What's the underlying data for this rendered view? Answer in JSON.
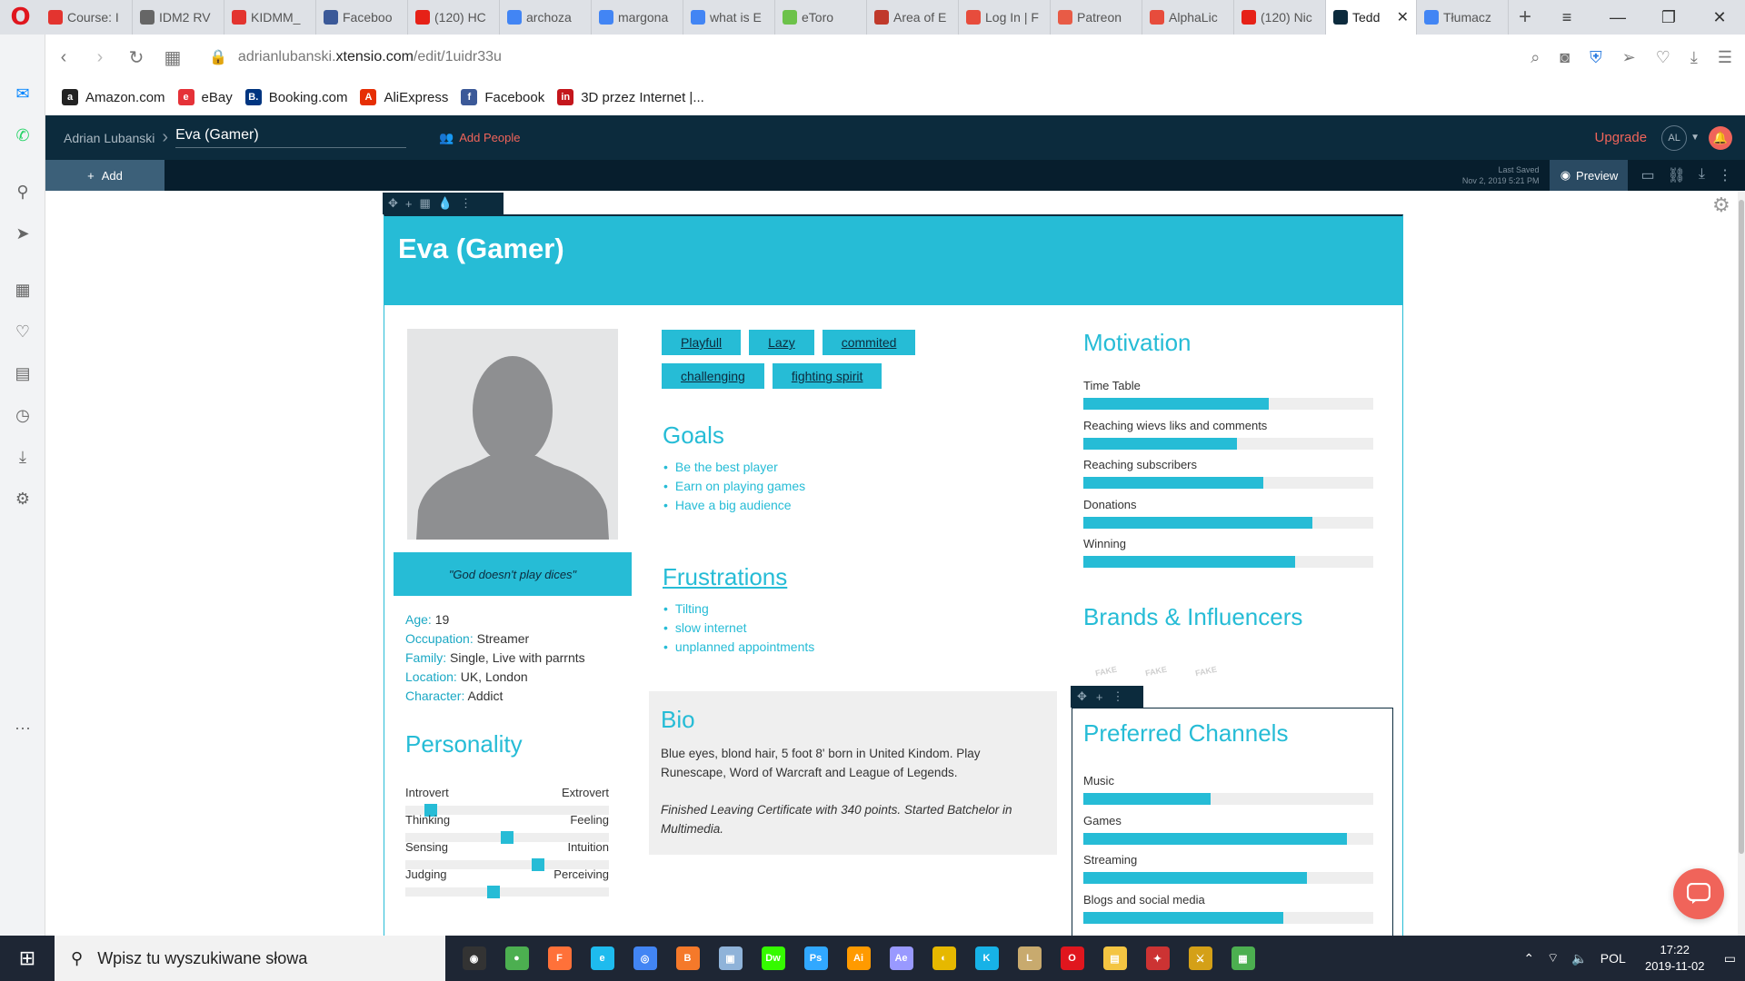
{
  "browser": {
    "logo": "O",
    "tabs": [
      {
        "label": "Course: I",
        "color": "#e3342f",
        "active": false
      },
      {
        "label": "IDM2 RV",
        "color": "#666666",
        "active": false
      },
      {
        "label": "KIDMM_",
        "color": "#e3342f",
        "active": false
      },
      {
        "label": "Faceboo",
        "color": "#3b5998",
        "active": false
      },
      {
        "label": "(120) HC",
        "color": "#e62117",
        "active": false
      },
      {
        "label": "archoza",
        "color": "#4285f4",
        "active": false
      },
      {
        "label": "margona",
        "color": "#4285f4",
        "active": false
      },
      {
        "label": "what is E",
        "color": "#4285f4",
        "active": false
      },
      {
        "label": "eToro",
        "color": "#6cc24a",
        "active": false
      },
      {
        "label": "Area of E",
        "color": "#c0392b",
        "active": false
      },
      {
        "label": "Log In | F",
        "color": "#e74c3c",
        "active": false
      },
      {
        "label": "Patreon",
        "color": "#e85b46",
        "active": false
      },
      {
        "label": "AlphaLic",
        "color": "#e74c3c",
        "active": false
      },
      {
        "label": "(120) Nic",
        "color": "#e62117",
        "active": false
      },
      {
        "label": "Tedd",
        "color": "#0c2b3d",
        "active": true
      },
      {
        "label": "Tłumacz",
        "color": "#4285f4",
        "active": false
      }
    ],
    "url_prefix": "adrianlubanski.",
    "url_domain": "xtensio.com",
    "url_path": "/edit/1uidr33u",
    "bookmarks": [
      {
        "label": "Amazon.com",
        "glyph": "a",
        "color": "#222222"
      },
      {
        "label": "eBay",
        "glyph": "e",
        "color": "#e53238"
      },
      {
        "label": "Booking.com",
        "glyph": "B.",
        "color": "#003580"
      },
      {
        "label": "AliExpress",
        "glyph": "A",
        "color": "#e62e04"
      },
      {
        "label": "Facebook",
        "glyph": "f",
        "color": "#3b5998"
      },
      {
        "label": "3D przez Internet |...",
        "glyph": "in",
        "color": "#c4161c"
      }
    ]
  },
  "app": {
    "owner": "Adrian Lubanski",
    "doc_title": "Eva (Gamer)",
    "add_people": "Add People",
    "upgrade": "Upgrade",
    "avatar_initials": "AL",
    "add_label": "Add",
    "last_saved_label": "Last Saved",
    "last_saved_time": "Nov 2, 2019 5:21 PM",
    "preview_label": "Preview"
  },
  "persona": {
    "name": "Eva (Gamer)",
    "quote": "\"God doesn't play dices\"",
    "demographics": [
      {
        "key": "Age:",
        "value": " 19"
      },
      {
        "key": "Occupation:",
        "value": " Streamer"
      },
      {
        "key": "Family:",
        "value": " Single, Live with parrnts"
      },
      {
        "key": "Location:",
        "value": " UK, London"
      },
      {
        "key": "Character:",
        "value": " Addict"
      }
    ],
    "tags": [
      "Playfull",
      "Lazy",
      "commited",
      "challenging",
      "fighting spirit"
    ],
    "goals_title": "Goals",
    "goals": [
      "Be the best player",
      "Earn on playing games",
      "Have a big audience"
    ],
    "frustrations_title": "Frustrations",
    "frustrations": [
      "Tilting",
      "slow internet",
      "unplanned appointments"
    ],
    "bio_title": "Bio",
    "bio_p1": "Blue eyes, blond hair, 5 foot 8' born in United Kindom. Play Runescape, Word of Warcraft and League of Legends.",
    "bio_p2": "Finished Leaving Certificate with 340 points. Started Batchelor in Multimedia.",
    "personality_title": "Personality",
    "personality": [
      {
        "left": "Introvert",
        "right": "Extrovert",
        "value": 0.1
      },
      {
        "left": "Thinking",
        "right": "Feeling",
        "value": 0.5
      },
      {
        "left": "Sensing",
        "right": "Intuition",
        "value": 0.66
      },
      {
        "left": "Judging",
        "right": "Perceiving",
        "value": 0.43
      }
    ],
    "motivation_title": "Motivation",
    "motivation": [
      {
        "label": "Time Table",
        "value": 0.64
      },
      {
        "label": "Reaching wievs liks and comments",
        "value": 0.53
      },
      {
        "label": "Reaching subscribers",
        "value": 0.62
      },
      {
        "label": "Donations",
        "value": 0.79
      },
      {
        "label": "Winning",
        "value": 0.73
      }
    ],
    "brands_title": "Brands & Influencers",
    "brands": [
      "FAKE",
      "FAKE",
      "FAKE"
    ],
    "channels_title": "Preferred Channels",
    "channels": [
      {
        "label": "Music",
        "value": 0.44
      },
      {
        "label": "Games",
        "value": 0.91
      },
      {
        "label": "Streaming",
        "value": 0.77
      },
      {
        "label": "Blogs and social media",
        "value": 0.69
      }
    ]
  },
  "taskbar": {
    "search_placeholder": "Wpisz tu wyszukiwane słowa",
    "apps": [
      {
        "name": "obs",
        "glyph": "◉",
        "color": "#333333"
      },
      {
        "name": "globe",
        "glyph": "●",
        "color": "#4caf50"
      },
      {
        "name": "firefox",
        "glyph": "F",
        "color": "#ff7139"
      },
      {
        "name": "ie",
        "glyph": "e",
        "color": "#1ebbee"
      },
      {
        "name": "chrome",
        "glyph": "◎",
        "color": "#4285f4"
      },
      {
        "name": "blender",
        "glyph": "B",
        "color": "#f5792a"
      },
      {
        "name": "cube",
        "glyph": "▣",
        "color": "#8fb3d9"
      },
      {
        "name": "dreamweaver",
        "glyph": "Dw",
        "color": "#35fa00"
      },
      {
        "name": "photoshop",
        "glyph": "Ps",
        "color": "#31a8ff"
      },
      {
        "name": "illustrator",
        "glyph": "Ai",
        "color": "#ff9a00"
      },
      {
        "name": "after-effects",
        "glyph": "Ae",
        "color": "#9999ff"
      },
      {
        "name": "app-2",
        "glyph": "◐",
        "color": "#e6b800"
      },
      {
        "name": "kodi",
        "glyph": "K",
        "color": "#17b2e7"
      },
      {
        "name": "league",
        "glyph": "L",
        "color": "#c8aa6e"
      },
      {
        "name": "opera",
        "glyph": "O",
        "color": "#e0161e"
      },
      {
        "name": "explorer",
        "glyph": "▤",
        "color": "#f4c542"
      },
      {
        "name": "app-3",
        "glyph": "✦",
        "color": "#cc3333"
      },
      {
        "name": "app-4",
        "glyph": "⚔",
        "color": "#d4a017"
      },
      {
        "name": "app-5",
        "glyph": "▦",
        "color": "#4caf50"
      }
    ],
    "lang": "POL",
    "time": "17:22",
    "date": "2019-11-02"
  }
}
